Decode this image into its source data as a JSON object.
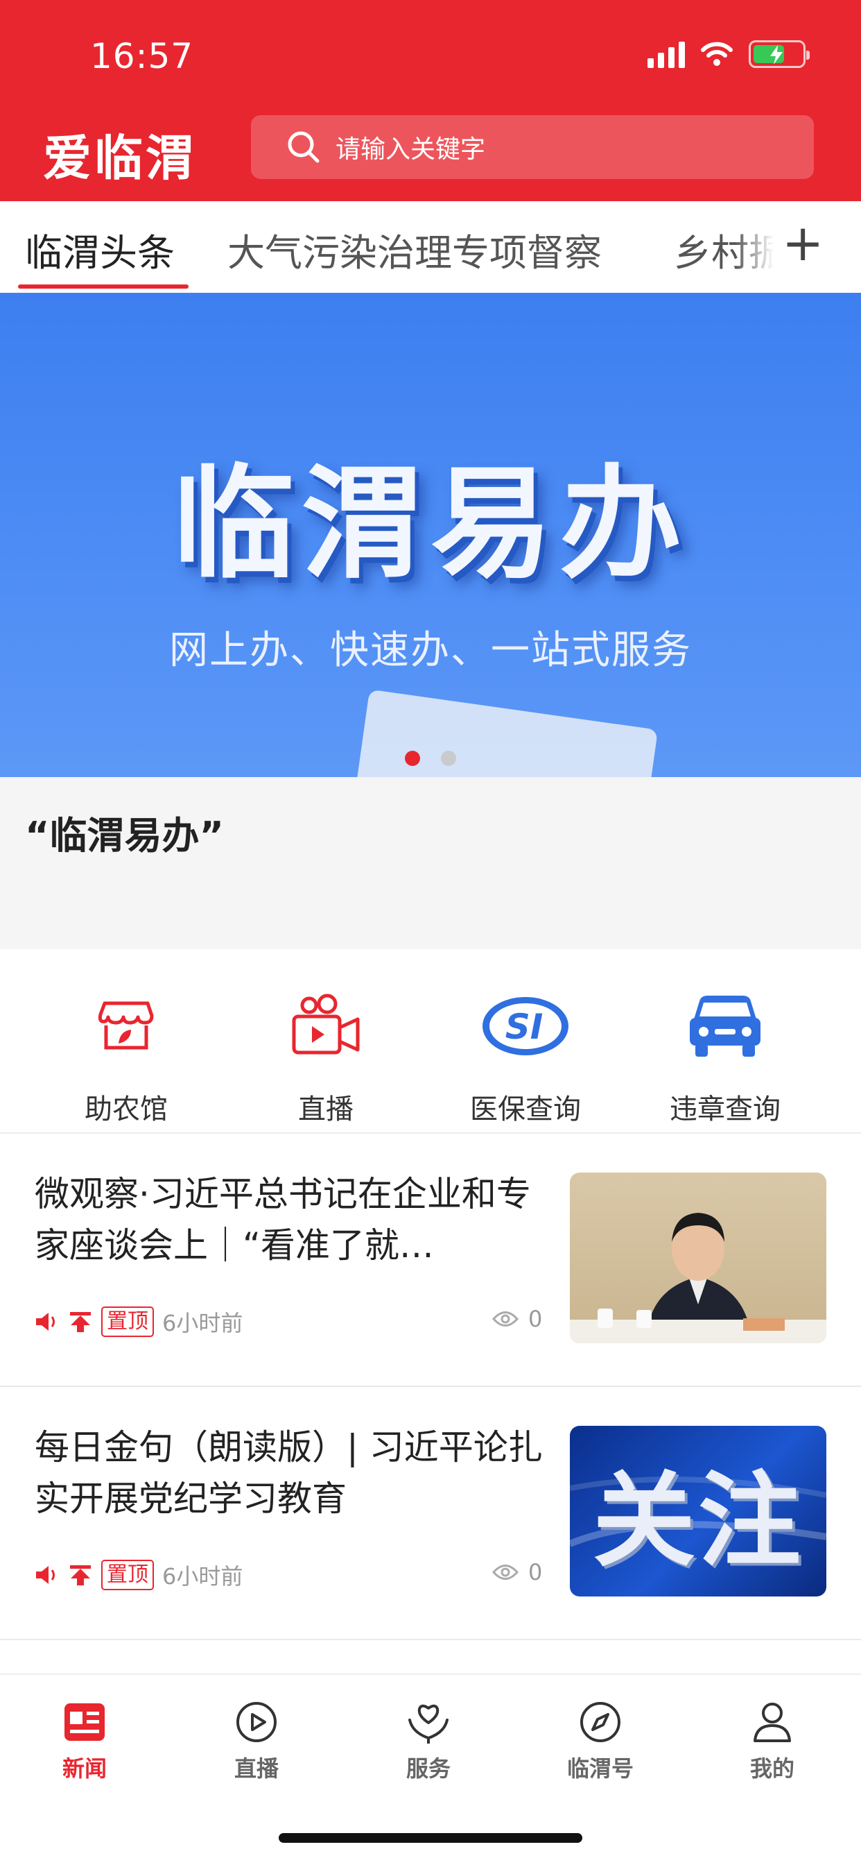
{
  "status_bar": {
    "time": "16:57"
  },
  "header": {
    "logo": "爱临渭",
    "search_placeholder": "请输入关键字"
  },
  "tabs": [
    {
      "label": "临渭头条",
      "active": true
    },
    {
      "label": "大气污染治理专项督察",
      "active": false
    },
    {
      "label": "乡村振",
      "active": false
    }
  ],
  "tab_more": "+",
  "banner": {
    "title": "临渭易办",
    "subtitle": "网上办、快速办、一站式服务",
    "caption": "“临渭易办”",
    "page_count": 2,
    "current_page": 1
  },
  "quick_services": [
    {
      "label": "助农馆",
      "icon": "farm-store-icon"
    },
    {
      "label": "直播",
      "icon": "video-camera-icon"
    },
    {
      "label": "医保查询",
      "icon": "social-insurance-icon"
    },
    {
      "label": "违章查询",
      "icon": "car-icon"
    }
  ],
  "news": [
    {
      "title": "微观察·习近平总书记在企业和专家座谈会上｜“看准了就…",
      "badge": "置顶",
      "time": "6小时前",
      "views": "0",
      "thumb": "photo"
    },
    {
      "title": "每日金句（朗读版）| 习近平论扎实开展党纪学习教育",
      "badge": "置顶",
      "time": "6小时前",
      "views": "0",
      "thumb": "关注"
    }
  ],
  "bottom_nav": [
    {
      "label": "新闻",
      "icon": "news-icon",
      "active": true
    },
    {
      "label": "直播",
      "icon": "play-icon",
      "active": false
    },
    {
      "label": "服务",
      "icon": "service-icon",
      "active": false
    },
    {
      "label": "临渭号",
      "icon": "compass-icon",
      "active": false
    },
    {
      "label": "我的",
      "icon": "user-icon",
      "active": false
    }
  ],
  "colors": {
    "brand_red": "#e8262f",
    "banner_blue": "#4f8ef5",
    "icon_blue": "#2f6fe0"
  }
}
